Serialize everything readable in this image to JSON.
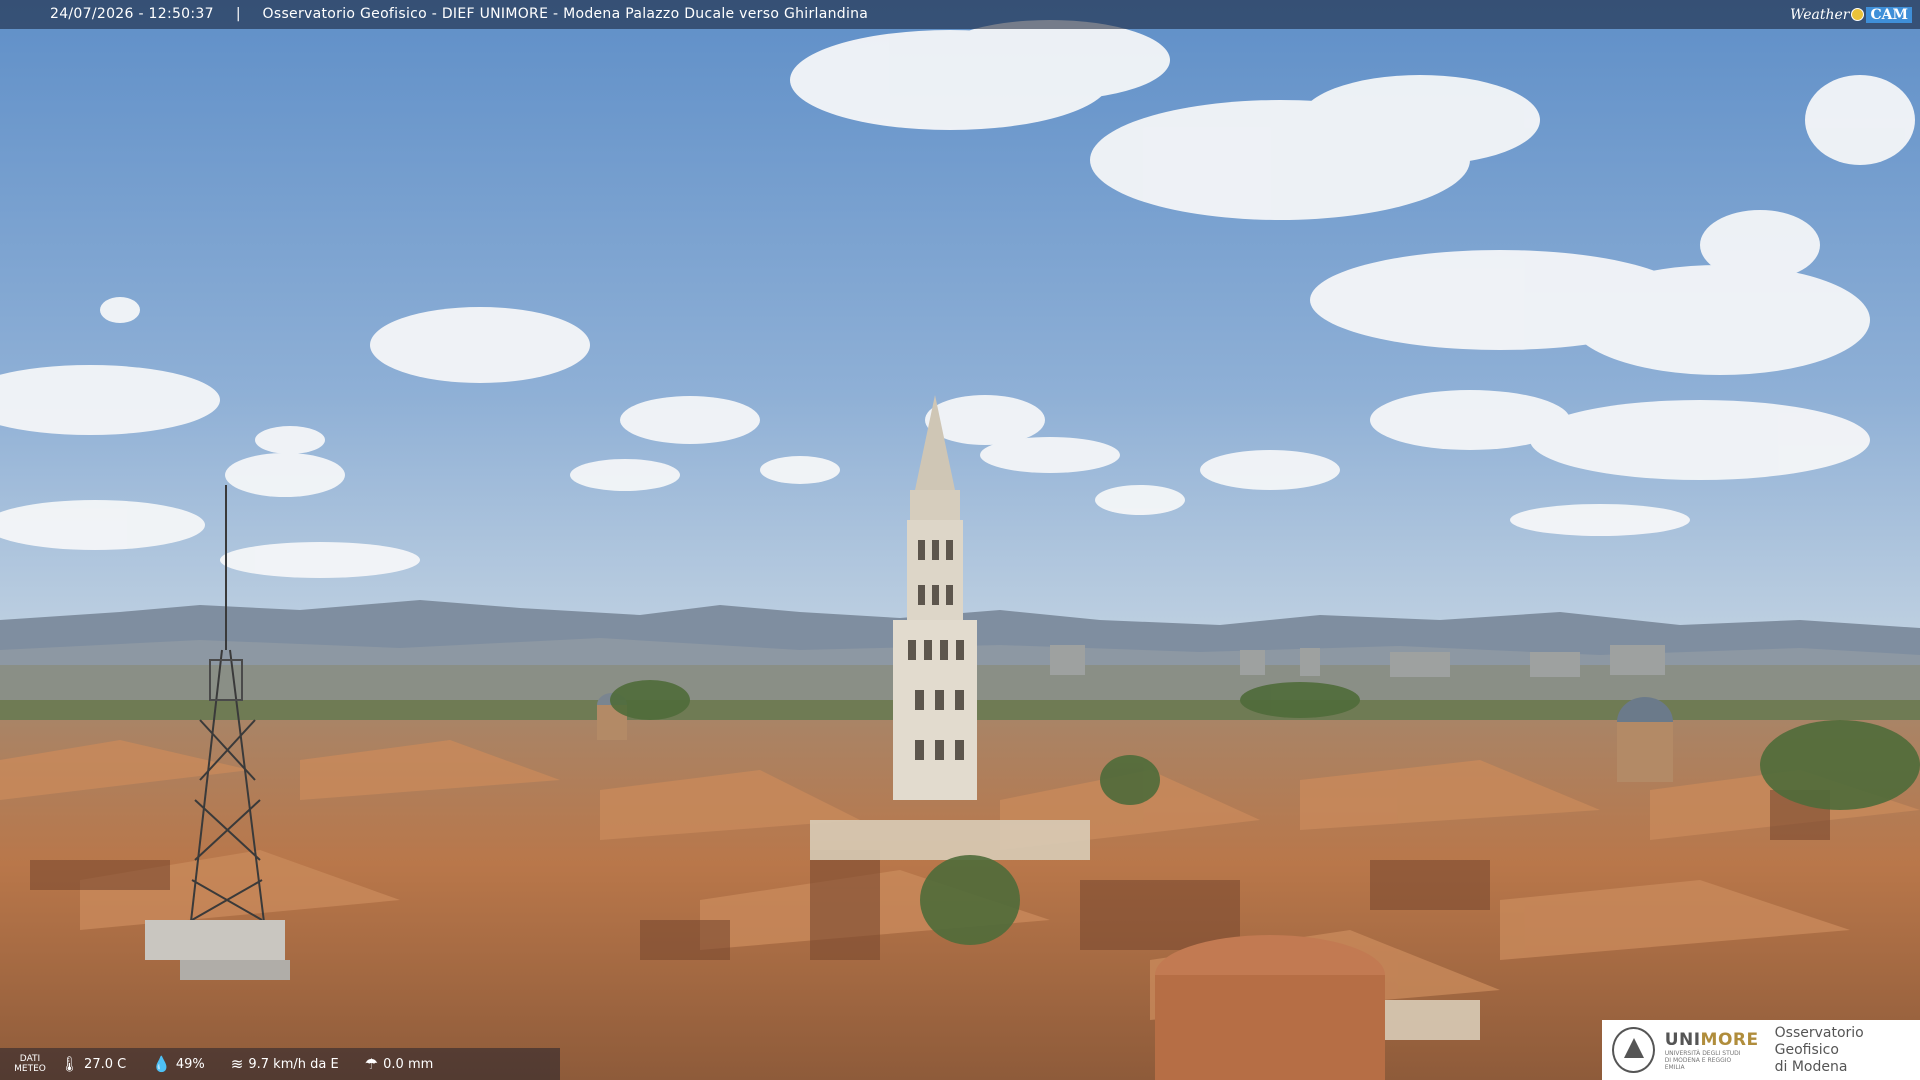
{
  "overlay": {
    "timestamp": "24/07/2026 - 12:50:37",
    "separator": "|",
    "camera_title": "Osservatorio Geofisico - DIEF UNIMORE - Modena Palazzo Ducale verso Ghirlandina",
    "brand_weather": "Weather",
    "brand_cam": "CAM"
  },
  "meteo": {
    "label_line1": "DATI",
    "label_line2": "METEO",
    "temperature": "27.0 C",
    "humidity": "49%",
    "wind": "9.7 km/h da E",
    "rain": "0.0 mm",
    "temperature_icon": "thermometer-icon",
    "humidity_icon": "droplet-icon",
    "wind_icon": "wind-icon",
    "rain_icon": "rain-icon"
  },
  "logo": {
    "uni_main": "UNI",
    "uni_more": "MORE",
    "uni_sub": "UNIVERSITÀ DEGLI STUDI DI MODENA E REGGIO EMILIA",
    "observatory_line1": "Osservatorio Geofisico",
    "observatory_line2": "di Modena"
  },
  "colors": {
    "sky_top": "#5f8fc8",
    "sky_bottom": "#b9cde0",
    "mountains": "#7f8ea0",
    "roofs": "#b9774a",
    "tower": "#ddd6c8"
  }
}
